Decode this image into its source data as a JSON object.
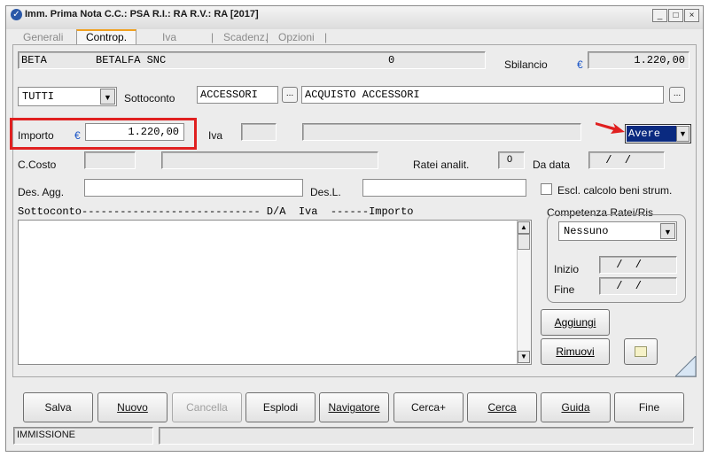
{
  "window": {
    "title": "Imm. Prima Nota C.C.: PSA  R.I.: RA  R.V.: RA  [2017]",
    "buttons": {
      "minimize": "_",
      "maximize": "□",
      "close": "×"
    }
  },
  "tabs": [
    {
      "label": "Generali"
    },
    {
      "label": "Controp."
    },
    {
      "label": "Iva"
    },
    {
      "label": "|"
    },
    {
      "label": "Scadenz."
    },
    {
      "label": "|"
    },
    {
      "label": "Opzioni"
    },
    {
      "label": "|"
    }
  ],
  "header": {
    "code": "BETA",
    "name": "BETALFA SNC",
    "number": "0",
    "sbilancio_label": "Sbilancio",
    "currency": "€",
    "sbilancio_value": "1.220,00"
  },
  "row2": {
    "filter_value": "TUTTI",
    "sottoconto_label": "Sottoconto",
    "sottoconto_code": "ACCESSORI",
    "sottoconto_desc": "ACQUISTO ACCESSORI",
    "dots": "..."
  },
  "row3": {
    "importo_label": "Importo",
    "currency": "€",
    "importo_value": "1.220,00",
    "iva_label": "Iva",
    "da_value": "Avere"
  },
  "row4": {
    "ccosto_label": "C.Costo",
    "ratei_label": "Ratei analit.",
    "ratei_value": "0",
    "dadata_label": "Da data",
    "dadata_value": " /  /"
  },
  "row5": {
    "desagg_label": "Des. Agg.",
    "desl_label": "Des.L.",
    "escl_label": "Escl. calcolo beni strum."
  },
  "list": {
    "header": "Sottoconto---------------------------- D/A  Iva  ------Importo"
  },
  "competenza": {
    "title": "Competenza Ratei/Ris",
    "select_value": "Nessuno",
    "inizio_label": "Inizio",
    "inizio_value": " /  /",
    "fine_label": "Fine",
    "fine_value": " /  /"
  },
  "side_buttons": {
    "aggiungi": "Aggiungi",
    "rimuovi": "Rimuovi"
  },
  "bottom_buttons": [
    {
      "label": "Salva"
    },
    {
      "label": "Nuovo"
    },
    {
      "label": "Cancella"
    },
    {
      "label": "Esplodi"
    },
    {
      "label": "Navigatore"
    },
    {
      "label": "Cerca+"
    },
    {
      "label": "Cerca"
    },
    {
      "label": "Guida"
    },
    {
      "label": "Fine"
    }
  ],
  "status": {
    "mode": "IMMISSIONE"
  },
  "colors": {
    "highlight_box": "#e02020",
    "avere_bg": "#0a2a80",
    "arrow": "#e02020"
  }
}
